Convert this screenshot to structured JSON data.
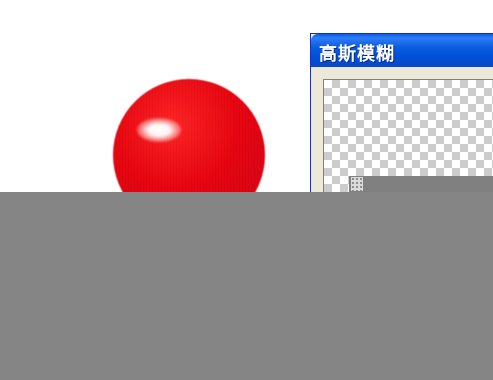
{
  "dialog": {
    "title": "高斯模糊"
  },
  "colors": {
    "ball": "#e8000c",
    "titlebar": "#0b5ddf",
    "overlay": "#858585"
  },
  "icons": {
    "preview_grip": "resize-grip-icon"
  }
}
